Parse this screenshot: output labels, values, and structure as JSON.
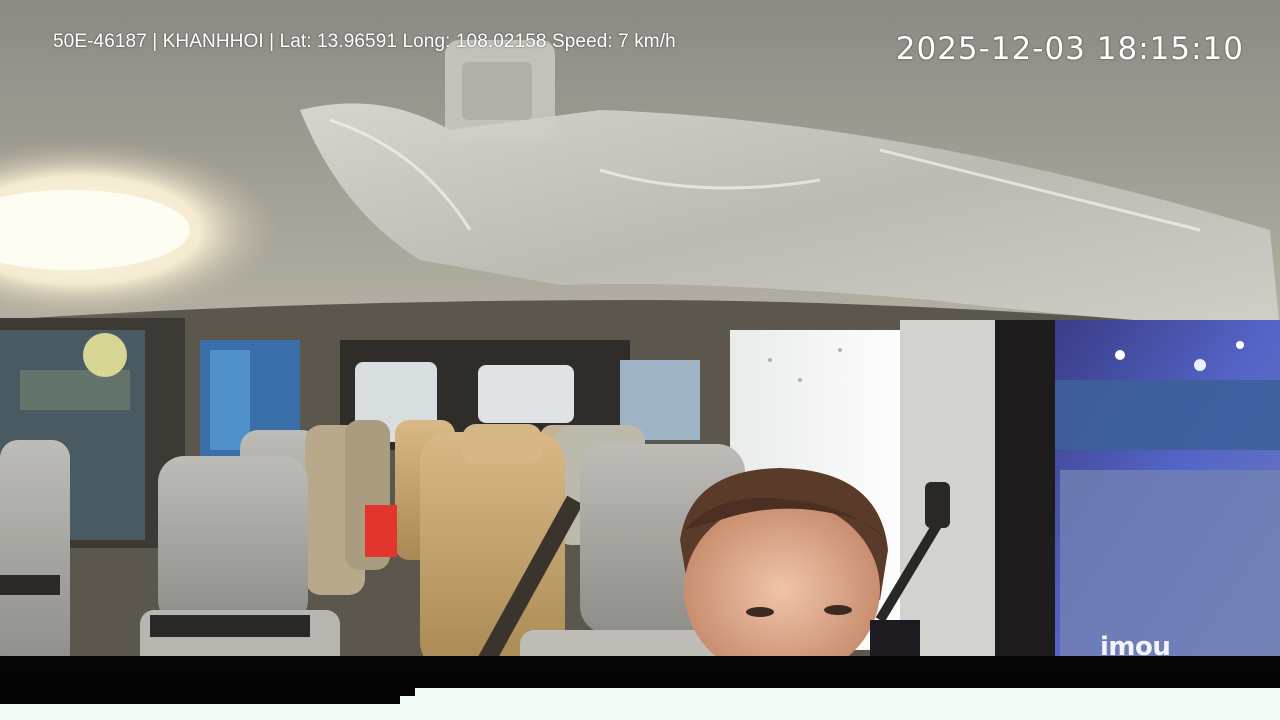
{
  "overlay": {
    "info_text": "50E-46187 | KHANHHOI | Lat: 13.96591 Long: 108.02158 Speed: 7 km/h",
    "timestamp": "2025-12-03 18:15:10",
    "watermark": "imou"
  },
  "scene": {
    "description_tag": "van-interior-camera",
    "colors": {
      "ceiling": "#9a9689",
      "seat_gray": "#a9a9a6",
      "seat_tan": "#c9a873",
      "window_blue": "#3a6ea8",
      "night_lights": "#6f7de0"
    }
  }
}
